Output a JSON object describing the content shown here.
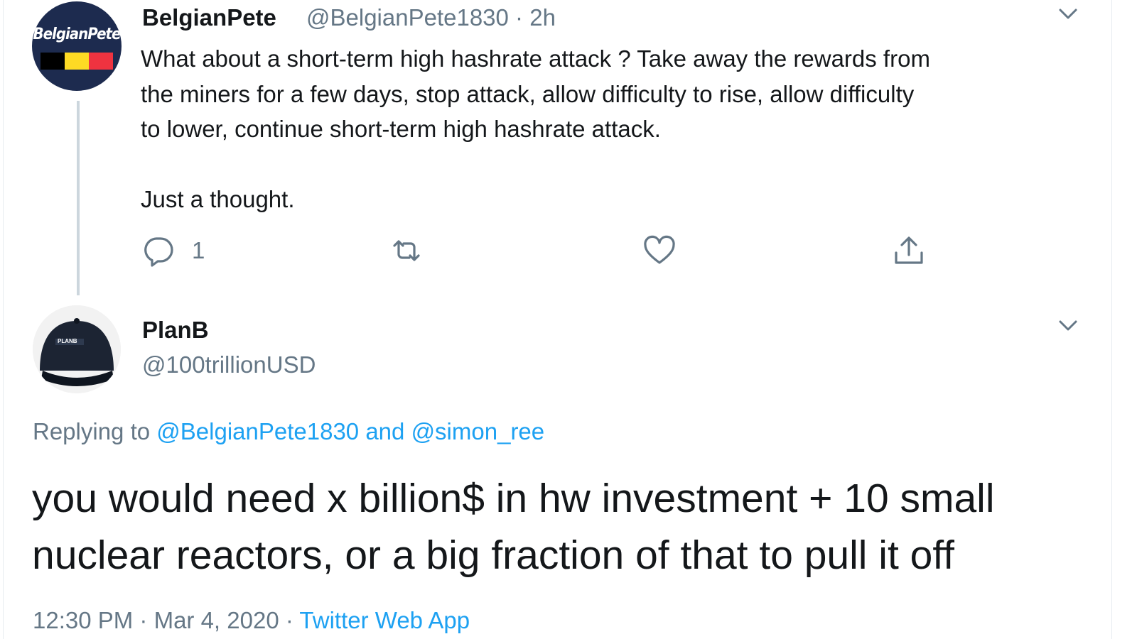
{
  "parent_tweet": {
    "name": "BelgianPete",
    "handle": "@BelgianPete1830",
    "separator": " · ",
    "time": "2h",
    "avatar_text": "BelgianPete",
    "body": "What about a short-term high hashrate attack ? Take away the rewards from\nthe miners for a few days, stop attack, allow difficulty to rise, allow difficulty\nto lower, continue short-term high hashrate attack.\n\nJust a thought.",
    "reply_count": "1",
    "icons": [
      "reply-icon",
      "retweet-icon",
      "like-icon",
      "share-icon",
      "chevron-down-icon"
    ]
  },
  "reply_tweet": {
    "name": "PlanB",
    "handle": "@100trillionUSD",
    "avatar_text": "PLANB",
    "replying_prefix": "Replying to ",
    "replying_user1": "@BelgianPete1830",
    "replying_and": " and ",
    "replying_user2": "@simon_ree",
    "body": "you would need x billion$ in hw investment + 10 small\nnuclear reactors, or a big fraction of that to pull it off",
    "time": "12:30 PM",
    "date": "Mar 4, 2020",
    "source": "Twitter Web App"
  },
  "colors": {
    "text": "#14171a",
    "secondary": "#657786",
    "link": "#1da1f2",
    "thread_line": "#ccd6dd",
    "flag_black": "#000000",
    "flag_yellow": "#fdda24",
    "flag_red": "#ef3340"
  }
}
